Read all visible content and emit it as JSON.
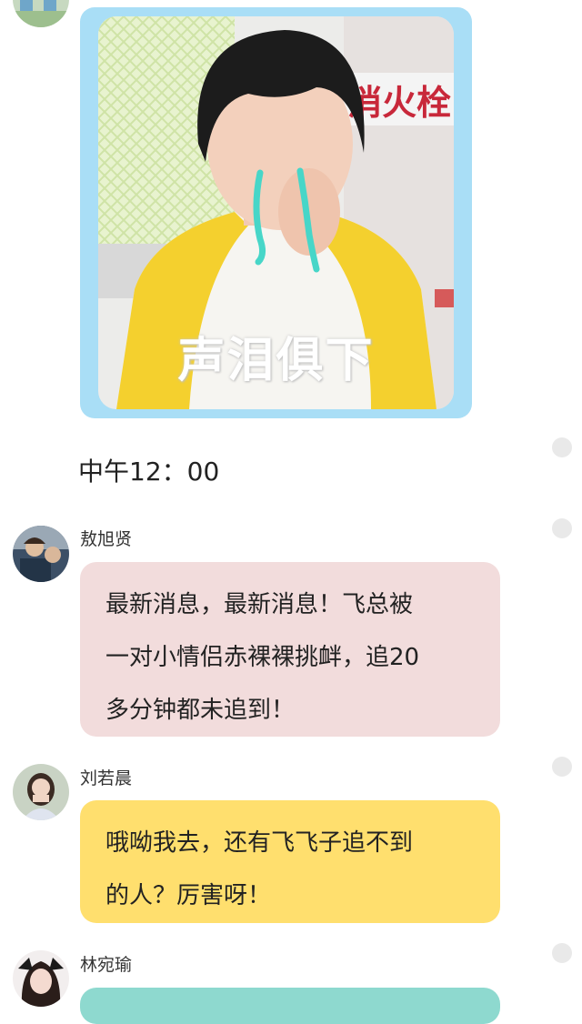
{
  "sticker": {
    "caption": "声泪俱下",
    "sign_text": "消火栓",
    "frame_color": "#a9def6"
  },
  "time_divider": {
    "text": "中午12：00"
  },
  "messages": [
    {
      "sender": "敖旭贤",
      "lines": [
        "最新消息，最新消息！飞总被",
        "一对小情侣赤裸裸挑衅，追20",
        "多分钟都未追到！"
      ],
      "bubble_color": "#f2dcdc"
    },
    {
      "sender": "刘若晨",
      "lines": [
        "哦呦我去，还有飞飞子追不到",
        "的人？厉害呀！"
      ],
      "bubble_color": "#ffdf6e"
    },
    {
      "sender": "林宛瑜",
      "lines": [],
      "bubble_color": "#8ed9cf"
    }
  ]
}
